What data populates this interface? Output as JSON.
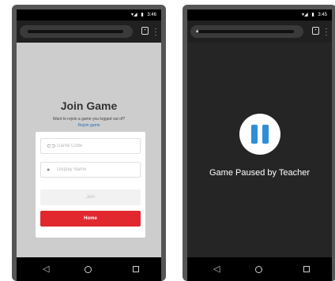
{
  "left_phone": {
    "status": {
      "time": "3:46"
    },
    "join": {
      "title": "Join Game",
      "rejoin_prompt": "Want to rejoin a game you logged out of?",
      "rejoin_link": "Rejoin game",
      "game_code_placeholder": "Game Code",
      "display_name_placeholder": "Display Name",
      "join_label": "Join",
      "home_label": "Home"
    }
  },
  "right_phone": {
    "status": {
      "time": "3:45"
    },
    "paused": {
      "message": "Game Paused by Teacher"
    }
  },
  "colors": {
    "home_button": "#e0282e",
    "pause_icon": "#2e8fd6",
    "link": "#2a6fb5"
  },
  "icons": {
    "tabs": "tab-switcher-icon",
    "menu": "overflow-menu-icon",
    "code": "link-icon",
    "name": "person-icon",
    "pause": "pause-icon",
    "back": "back-triangle-icon",
    "home": "home-circle-icon",
    "recent": "recents-square-icon"
  }
}
